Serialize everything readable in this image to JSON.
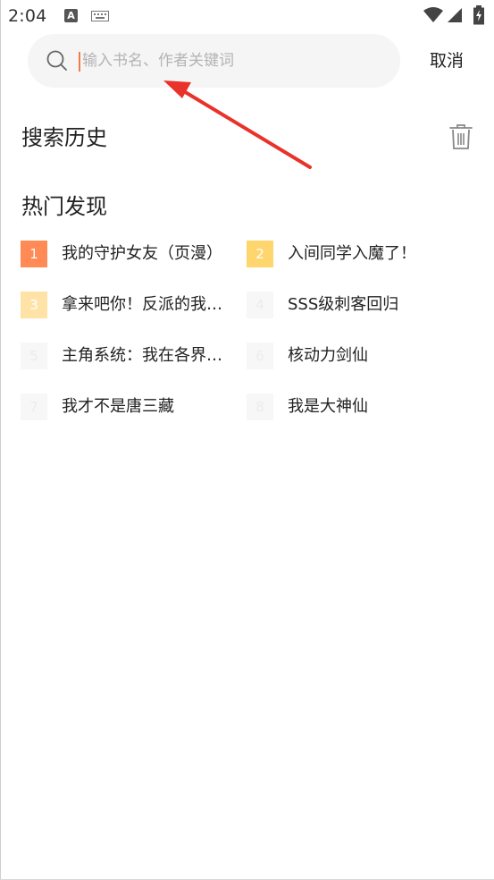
{
  "status_bar": {
    "time": "2:04",
    "a_badge": "A"
  },
  "search": {
    "placeholder": "输入书名、作者关键词",
    "value": "",
    "cancel_label": "取消"
  },
  "history": {
    "title": "搜索历史"
  },
  "hot": {
    "title": "热门发现",
    "items": [
      {
        "rank": "1",
        "name": "我的守护女友（页漫）",
        "badge_color": "#ff8a55",
        "text_color": "#ffffff"
      },
      {
        "rank": "2",
        "name": "入间同学入魔了！",
        "badge_color": "#ffd56e",
        "text_color": "#ffffff"
      },
      {
        "rank": "3",
        "name": "拿来吧你！反派的我…",
        "badge_color": "#ffe3a6",
        "text_color": "#ffffff"
      },
      {
        "rank": "4",
        "name": "SSS级刺客回归",
        "badge_color": "#f7f7f7",
        "text_color": "#ececec"
      },
      {
        "rank": "5",
        "name": "主角系统：我在各界…",
        "badge_color": "#f7f7f7",
        "text_color": "#ececec"
      },
      {
        "rank": "6",
        "name": "核动力剑仙",
        "badge_color": "#f7f7f7",
        "text_color": "#ececec"
      },
      {
        "rank": "7",
        "name": "我才不是唐三藏",
        "badge_color": "#f7f7f7",
        "text_color": "#ececec"
      },
      {
        "rank": "8",
        "name": "我是大神仙",
        "badge_color": "#f7f7f7",
        "text_color": "#ececec"
      }
    ]
  },
  "colors": {
    "accent": "#f07b4a",
    "annotation_arrow": "#e8322a"
  }
}
